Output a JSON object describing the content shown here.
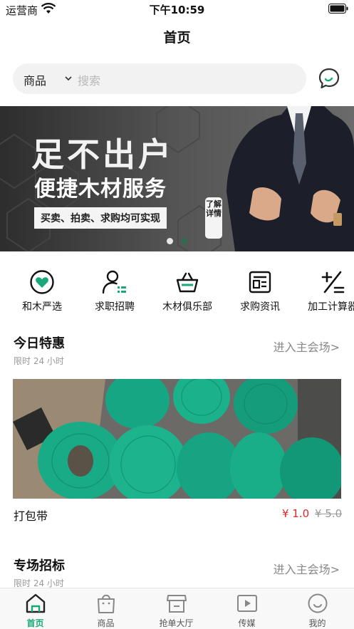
{
  "status_bar": {
    "carrier": "运营商",
    "time": "下午10:59"
  },
  "nav": {
    "title": "首页"
  },
  "search": {
    "category": "商品",
    "placeholder": "搜索"
  },
  "banner": {
    "title": "足不出户",
    "subtitle": "便捷木材服务",
    "tag": "买卖、拍卖、求购均可实现",
    "detail": "了解详情",
    "active_slide": 1,
    "slide_count": 2
  },
  "quick_menu": [
    {
      "label": "和木严选",
      "icon": "heart-icon"
    },
    {
      "label": "求职招聘",
      "icon": "user-list-icon"
    },
    {
      "label": "木材俱乐部",
      "icon": "basket-icon"
    },
    {
      "label": "求购资讯",
      "icon": "news-icon"
    },
    {
      "label": "加工计算器",
      "icon": "calculator-icon"
    }
  ],
  "today_deals": {
    "title": "今日特惠",
    "subtitle": "限时 24 小时",
    "more": "进入主会场>",
    "product": {
      "name": "打包带",
      "price": "¥ 1.0",
      "old_price": "¥ 5.0"
    }
  },
  "special_bids": {
    "title": "专场招标",
    "subtitle": "限时 24 小时",
    "more": "进入主会场>"
  },
  "tab_bar": [
    {
      "label": "首页",
      "icon": "home-icon",
      "active": true
    },
    {
      "label": "商品",
      "icon": "shopping-bag-icon",
      "active": false
    },
    {
      "label": "抢单大厅",
      "icon": "store-icon",
      "active": false
    },
    {
      "label": "传媒",
      "icon": "play-icon",
      "active": false
    },
    {
      "label": "我的",
      "icon": "smile-icon",
      "active": false
    }
  ],
  "colors": {
    "accent": "#1aa87a",
    "price": "#e0262b",
    "muted": "#999999"
  }
}
